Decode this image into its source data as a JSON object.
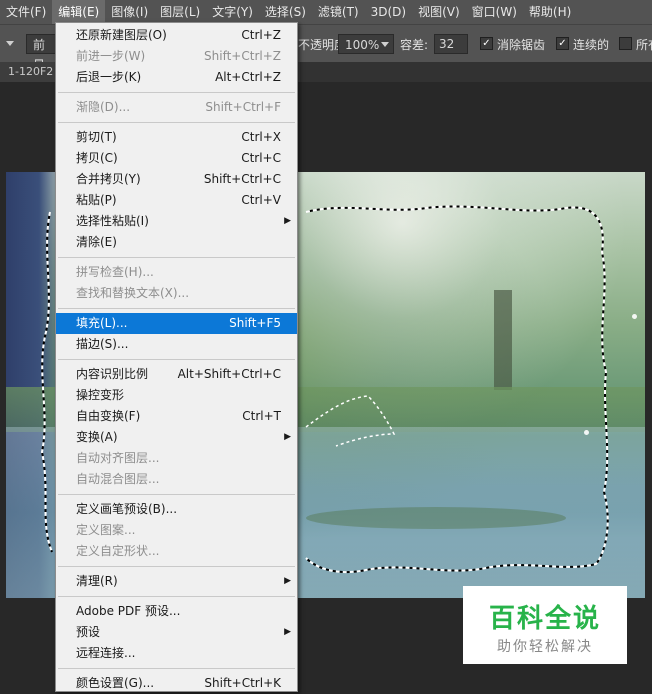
{
  "menubar": {
    "items": [
      "文件(F)",
      "编辑(E)",
      "图像(I)",
      "图层(L)",
      "文字(Y)",
      "选择(S)",
      "滤镜(T)",
      "3D(D)",
      "视图(V)",
      "窗口(W)",
      "帮助(H)"
    ],
    "active_index": 1
  },
  "options": {
    "preset_label": "前景",
    "opacity_label": "不透明度:",
    "opacity_value": "100%",
    "tolerance_label": "容差:",
    "tolerance_value": "32",
    "antialias_label": "消除锯齿",
    "contiguous_label": "连续的",
    "all_layers_label": "所有"
  },
  "document": {
    "tab_title": "1-120F2"
  },
  "edit_menu": {
    "items": [
      {
        "label": "还原新建图层(O)",
        "shortcut": "Ctrl+Z",
        "disabled": false
      },
      {
        "label": "前进一步(W)",
        "shortcut": "Shift+Ctrl+Z",
        "disabled": true
      },
      {
        "label": "后退一步(K)",
        "shortcut": "Alt+Ctrl+Z",
        "disabled": false
      },
      {
        "separator": true
      },
      {
        "label": "渐隐(D)...",
        "shortcut": "Shift+Ctrl+F",
        "disabled": true
      },
      {
        "separator": true
      },
      {
        "label": "剪切(T)",
        "shortcut": "Ctrl+X",
        "disabled": false
      },
      {
        "label": "拷贝(C)",
        "shortcut": "Ctrl+C",
        "disabled": false
      },
      {
        "label": "合并拷贝(Y)",
        "shortcut": "Shift+Ctrl+C",
        "disabled": false
      },
      {
        "label": "粘贴(P)",
        "shortcut": "Ctrl+V",
        "disabled": false
      },
      {
        "label": "选择性粘贴(I)",
        "shortcut": "",
        "submenu": true,
        "disabled": false
      },
      {
        "label": "清除(E)",
        "shortcut": "",
        "disabled": false
      },
      {
        "separator": true
      },
      {
        "label": "拼写检查(H)...",
        "shortcut": "",
        "disabled": true
      },
      {
        "label": "查找和替换文本(X)...",
        "shortcut": "",
        "disabled": true
      },
      {
        "separator": true
      },
      {
        "label": "填充(L)...",
        "shortcut": "Shift+F5",
        "disabled": false,
        "highlight": true
      },
      {
        "label": "描边(S)...",
        "shortcut": "",
        "disabled": false
      },
      {
        "separator": true
      },
      {
        "label": "内容识别比例",
        "shortcut": "Alt+Shift+Ctrl+C",
        "disabled": false
      },
      {
        "label": "操控变形",
        "shortcut": "",
        "disabled": false
      },
      {
        "label": "自由变换(F)",
        "shortcut": "Ctrl+T",
        "disabled": false
      },
      {
        "label": "变换(A)",
        "shortcut": "",
        "submenu": true,
        "disabled": false
      },
      {
        "label": "自动对齐图层...",
        "shortcut": "",
        "disabled": true
      },
      {
        "label": "自动混合图层...",
        "shortcut": "",
        "disabled": true
      },
      {
        "separator": true
      },
      {
        "label": "定义画笔预设(B)...",
        "shortcut": "",
        "disabled": false
      },
      {
        "label": "定义图案...",
        "shortcut": "",
        "disabled": true
      },
      {
        "label": "定义自定形状...",
        "shortcut": "",
        "disabled": true
      },
      {
        "separator": true
      },
      {
        "label": "清理(R)",
        "shortcut": "",
        "submenu": true,
        "disabled": false
      },
      {
        "separator": true
      },
      {
        "label": "Adobe PDF 预设...",
        "shortcut": "",
        "disabled": false
      },
      {
        "label": "预设",
        "shortcut": "",
        "submenu": true,
        "disabled": false
      },
      {
        "label": "远程连接...",
        "shortcut": "",
        "disabled": false
      },
      {
        "separator": true
      },
      {
        "label": "颜色设置(G)...",
        "shortcut": "Shift+Ctrl+K",
        "disabled": false
      }
    ]
  },
  "watermark": {
    "title": "百科全说",
    "subtitle": "助你轻松解决"
  },
  "colors": {
    "menubar_bg": "#535353",
    "menu_bg": "#f0f0f0",
    "highlight": "#0c78d7",
    "watermark_green": "#28b34a"
  },
  "icons": {
    "submenu_arrow": "triangle-right-icon",
    "checkbox_check": "check-icon"
  }
}
